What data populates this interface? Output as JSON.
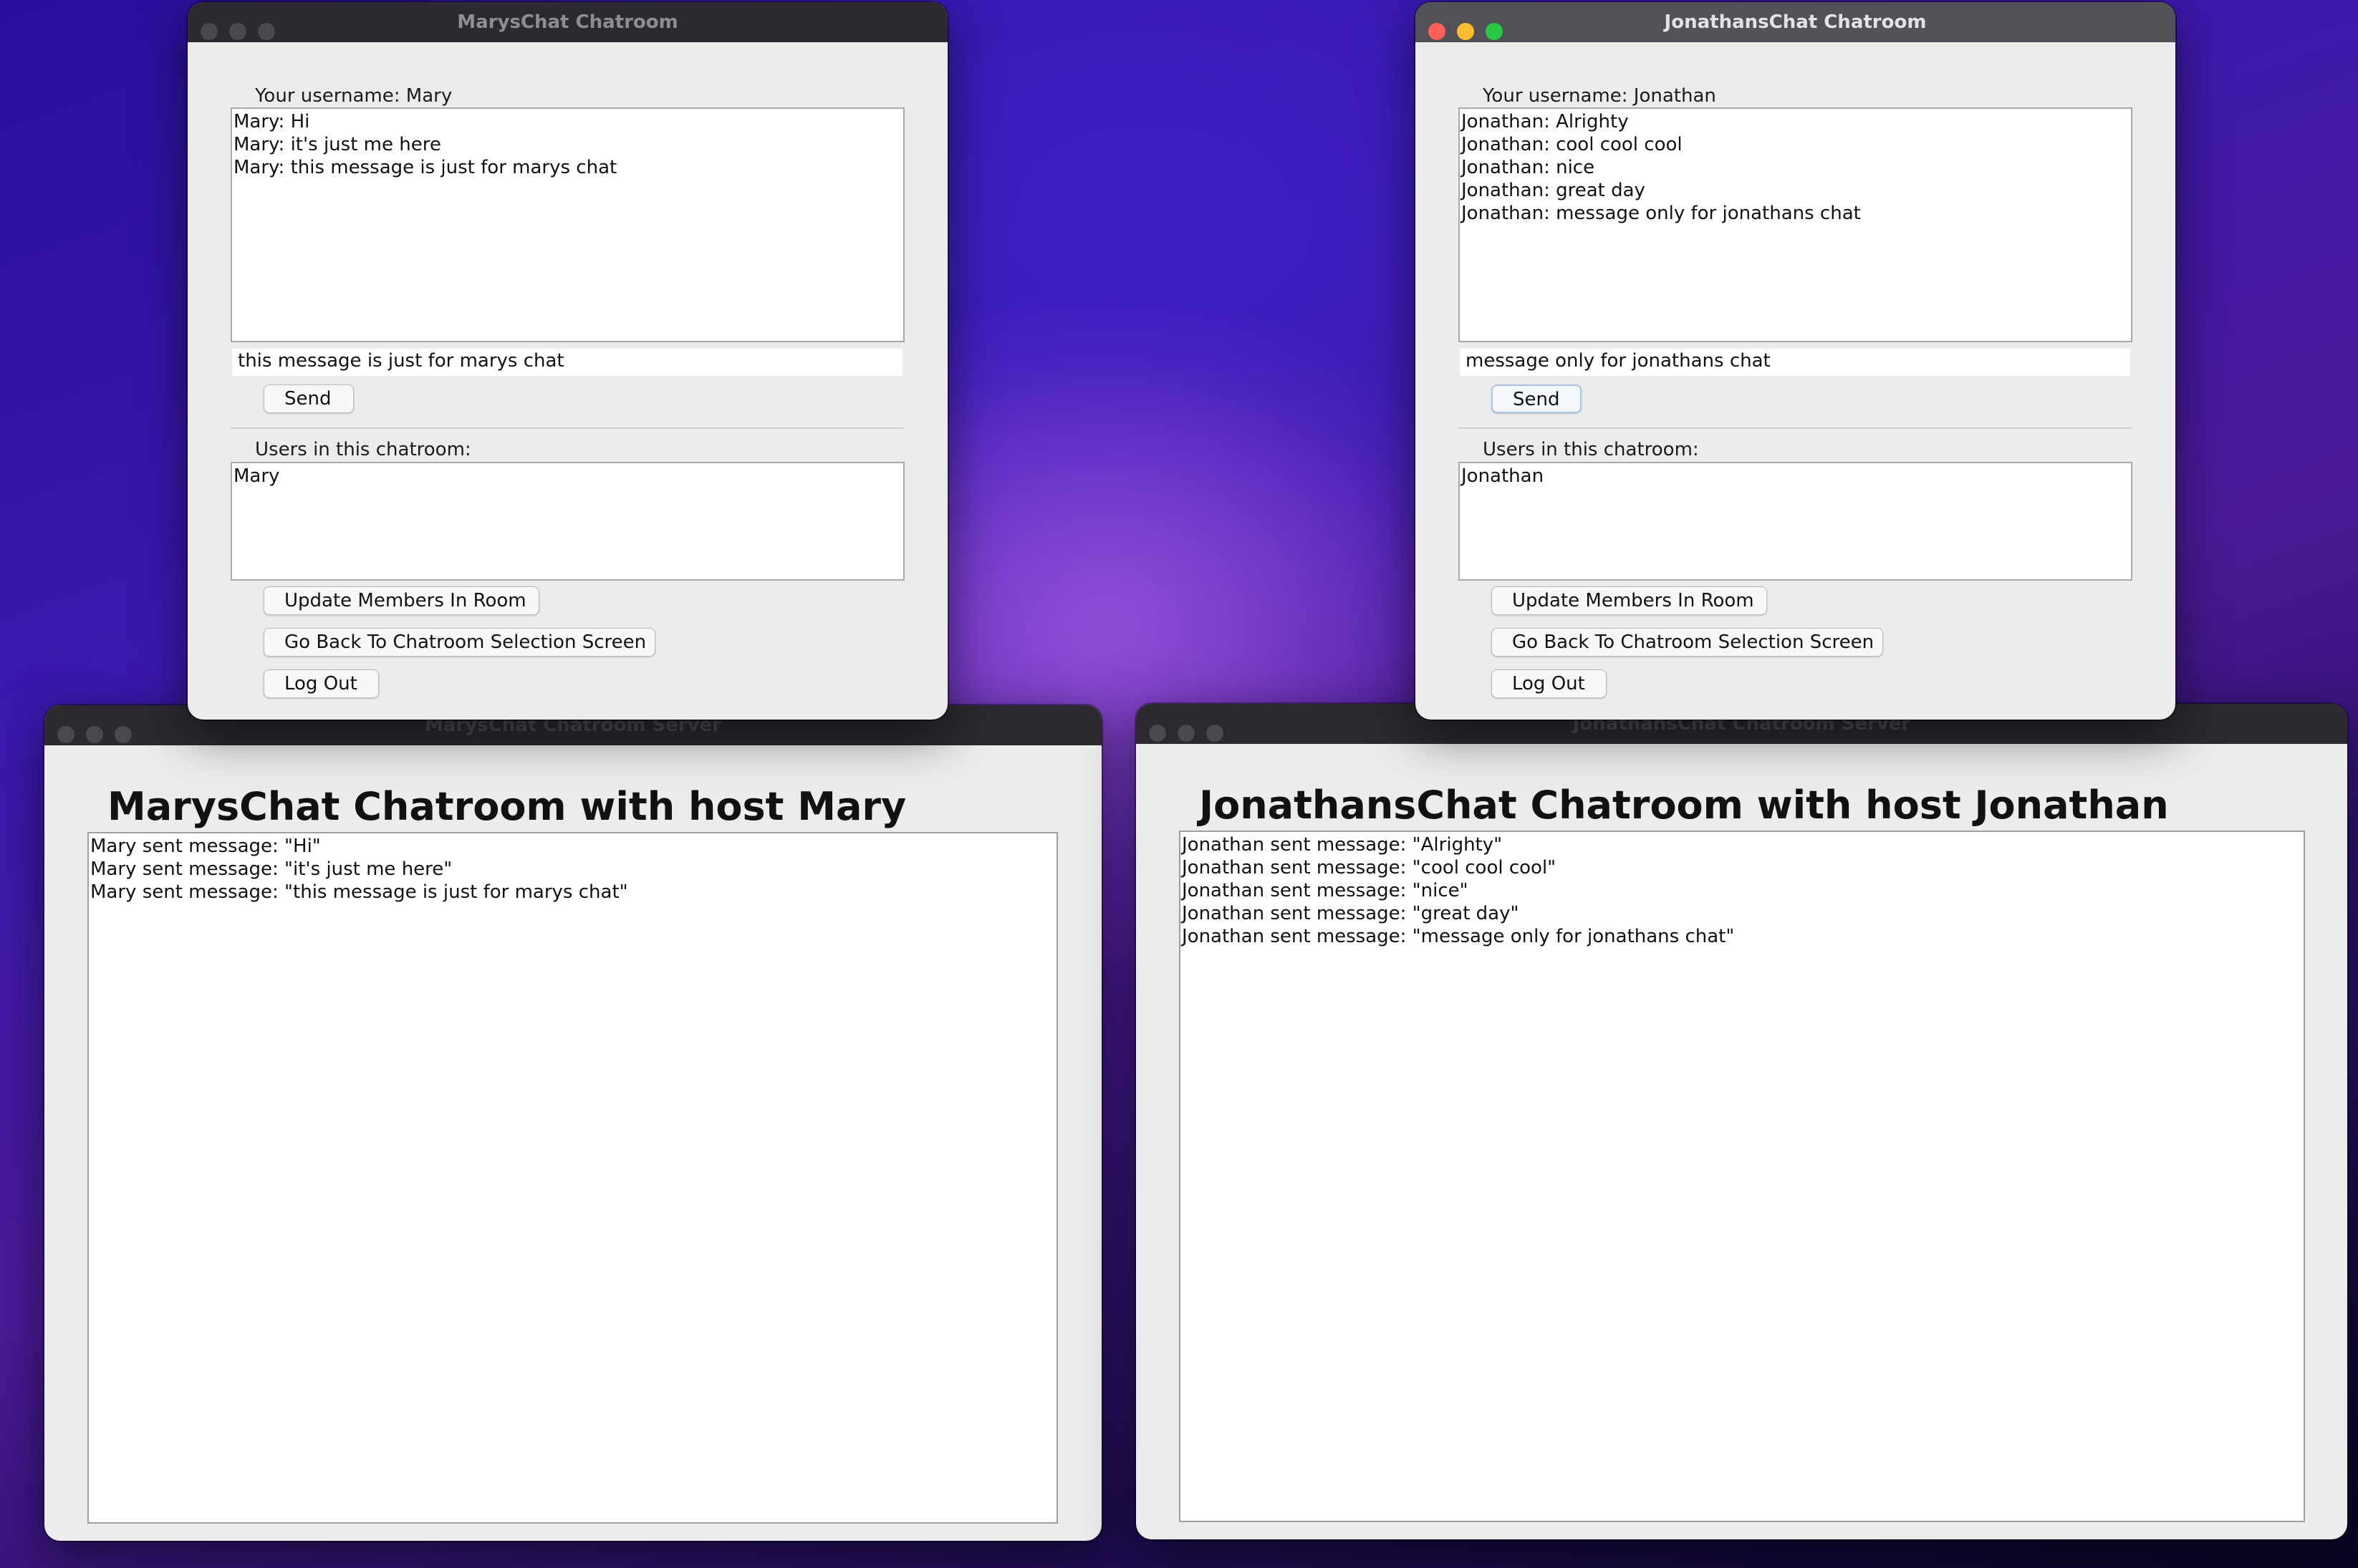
{
  "mary_client": {
    "title": "MarysChat Chatroom",
    "username_label": "Your username: Mary",
    "messages": [
      "Mary: Hi",
      "Mary: it's just me here",
      "Mary: this message is just for marys chat"
    ],
    "input_value": "this message is just for marys chat",
    "send_label": "Send",
    "users_label": "Users in this chatroom:",
    "users": [
      "Mary"
    ],
    "update_label": "Update Members In Room",
    "back_label": "Go Back To Chatroom Selection Screen",
    "logout_label": "Log Out"
  },
  "jonathan_client": {
    "title": "JonathansChat Chatroom",
    "username_label": "Your username: Jonathan",
    "messages": [
      "Jonathan: Alrighty",
      "Jonathan: cool cool cool",
      "Jonathan: nice",
      "Jonathan: great day",
      "Jonathan: message only for jonathans chat"
    ],
    "input_value": "message only for jonathans chat",
    "send_label": "Send",
    "users_label": "Users in this chatroom:",
    "users": [
      "Jonathan"
    ],
    "update_label": "Update Members In Room",
    "back_label": "Go Back To Chatroom Selection Screen",
    "logout_label": "Log Out"
  },
  "mary_server": {
    "title": "MarysChat Chatroom Server",
    "heading": "MarysChat Chatroom with host Mary",
    "log": [
      "Mary sent message: \"Hi\"",
      "Mary sent message: \"it's just me here\"",
      "Mary sent message: \"this message is just for marys chat\""
    ]
  },
  "jonathan_server": {
    "title": "JonathansChat Chatroom Server",
    "heading": "JonathansChat Chatroom with host Jonathan",
    "log": [
      "Jonathan sent message: \"Alrighty\"",
      "Jonathan sent message: \"cool cool cool\"",
      "Jonathan sent message: \"nice\"",
      "Jonathan sent message: \"great day\"",
      "Jonathan sent message: \"message only for jonathans chat\""
    ]
  },
  "colors": {
    "traffic_red": "#fe5f57",
    "traffic_yellow": "#febc2e",
    "traffic_green": "#28c840",
    "window_bg": "#ececec",
    "titlebar_inactive": "#2c2a30",
    "titlebar_active": "#535158"
  }
}
